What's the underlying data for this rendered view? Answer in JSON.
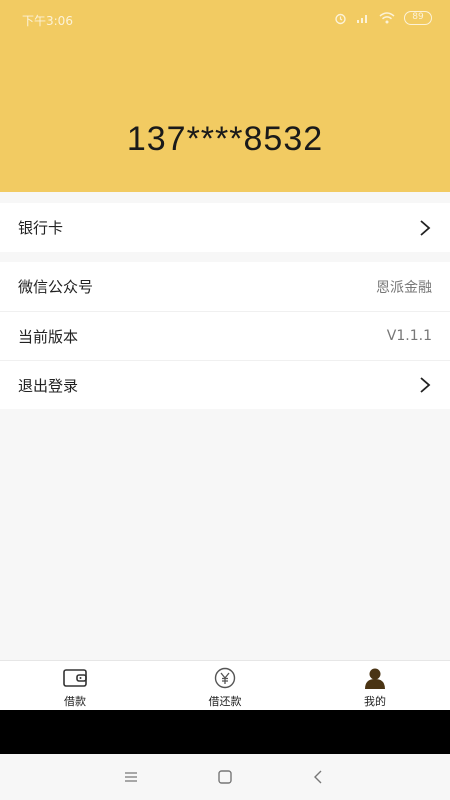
{
  "status_bar": {
    "time": "下午3:06",
    "battery": "89"
  },
  "header": {
    "phone": "137****8532",
    "background_color": "#f2cb62"
  },
  "menu": {
    "bank_card": {
      "label": "银行卡"
    },
    "wechat": {
      "label": "微信公众号",
      "value": "恩派金融"
    },
    "version": {
      "label": "当前版本",
      "value": "V1.1.1"
    },
    "logout": {
      "label": "退出登录"
    }
  },
  "tabs": [
    {
      "label": "借款",
      "icon": "wallet-icon"
    },
    {
      "label": "借还款",
      "icon": "yen-circle-icon"
    },
    {
      "label": "我的",
      "icon": "person-icon"
    }
  ],
  "nav": {
    "icons": [
      "menu-icon",
      "home-icon",
      "back-icon"
    ]
  }
}
